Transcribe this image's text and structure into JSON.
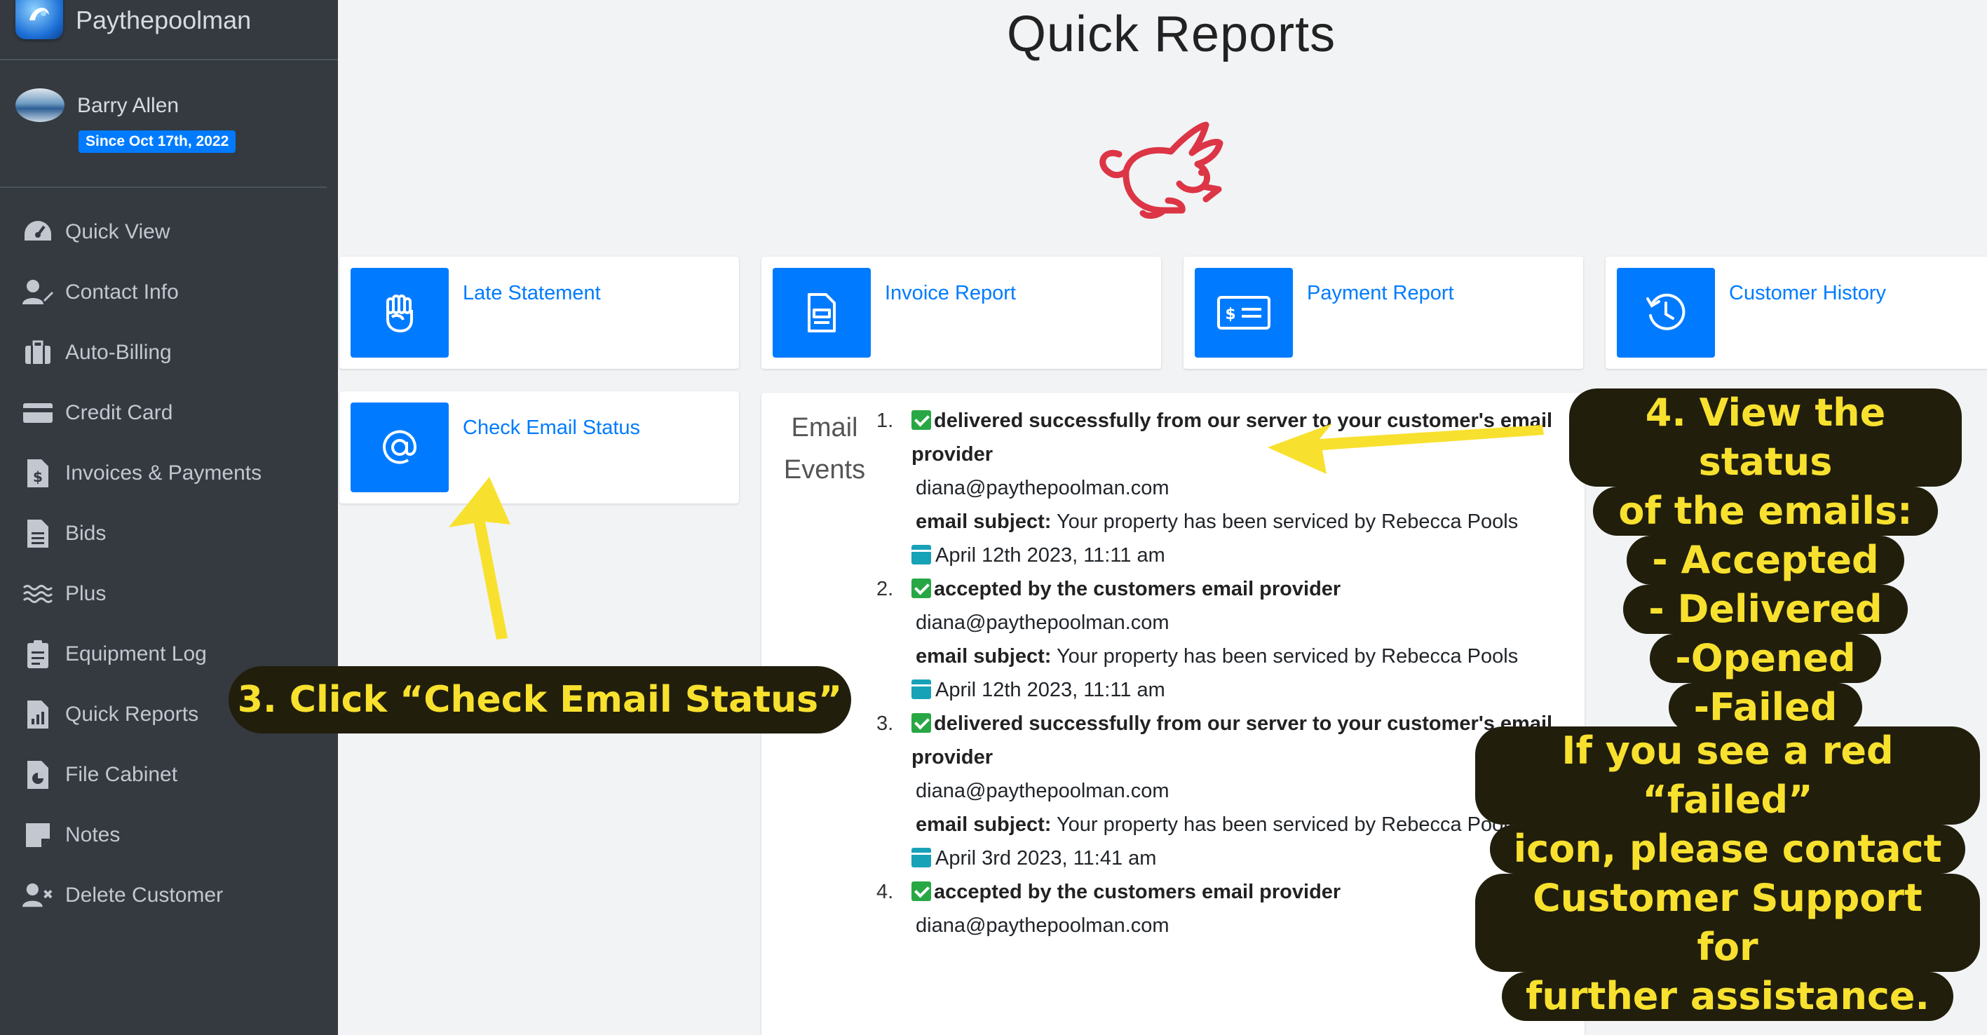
{
  "brand": {
    "name": "Paythepoolman"
  },
  "user": {
    "name": "Barry Allen",
    "since": "Since Oct 17th, 2022"
  },
  "nav": [
    {
      "label": "Quick View",
      "icon": "gauge-icon"
    },
    {
      "label": "Contact Info",
      "icon": "user-pen-icon"
    },
    {
      "label": "Auto-Billing",
      "icon": "briefcase-icon"
    },
    {
      "label": "Credit Card",
      "icon": "credit-card-icon"
    },
    {
      "label": "Invoices & Payments",
      "icon": "file-dollar-icon"
    },
    {
      "label": "Bids",
      "icon": "file-text-icon"
    },
    {
      "label": "Plus",
      "icon": "water-icon"
    },
    {
      "label": "Equipment Log",
      "icon": "clipboard-list-icon"
    },
    {
      "label": "Quick Reports",
      "icon": "file-chart-icon"
    },
    {
      "label": "File Cabinet",
      "icon": "file-pie-icon"
    },
    {
      "label": "Notes",
      "icon": "sticky-note-icon"
    },
    {
      "label": "Delete Customer",
      "icon": "user-x-icon"
    }
  ],
  "main": {
    "title": "Quick Reports",
    "cards": [
      {
        "label": "Late Statement",
        "icon": "fist-icon"
      },
      {
        "label": "Invoice Report",
        "icon": "invoice-icon"
      },
      {
        "label": "Payment Report",
        "icon": "money-check-icon"
      },
      {
        "label": "Customer History",
        "icon": "history-icon"
      },
      {
        "label": "Check Email Status",
        "icon": "at-icon"
      }
    ],
    "email_events": {
      "title": "Email Events",
      "events": [
        {
          "num": "1.",
          "status": "delivered successfully from our server to your customer's email provider",
          "email": "diana@paythepoolman.com",
          "subject_label": "email subject:",
          "subject": "Your property has been serviced by Rebecca Pools",
          "date": "April 12th 2023, 11:11 am"
        },
        {
          "num": "2.",
          "status": "accepted by the customers email provider",
          "email": "diana@paythepoolman.com",
          "subject_label": "email subject:",
          "subject": "Your property has been serviced by Rebecca Pools",
          "date": "April 12th 2023, 11:11 am"
        },
        {
          "num": "3.",
          "status": "delivered successfully from our server to your customer's email provider",
          "email": "diana@paythepoolman.com",
          "subject_label": "email subject:",
          "subject": "Your property has been serviced by Rebecca Pools",
          "date": "April 3rd 2023, 11:41 am"
        },
        {
          "num": "4.",
          "status": "accepted by the customers email provider",
          "email": "diana@paythepoolman.com",
          "subject_label": "",
          "subject": "",
          "date": ""
        }
      ]
    }
  },
  "callouts": {
    "step3": "3. Click “Check Email Status”",
    "step4": [
      "4. View the status",
      "of the emails:",
      "- Accepted",
      "- Delivered",
      "-Opened",
      "-Failed"
    ],
    "note": [
      "If you see a red “failed”",
      "icon, please contact",
      "Customer Support for",
      "further assistance."
    ]
  },
  "colors": {
    "sidebar": "#343a40",
    "primary": "#007bff",
    "success": "#28a745",
    "info": "#17a2b8",
    "rabbit": "#dc3545",
    "callout_bg": "#211e0c",
    "callout_text": "#f8e12e"
  }
}
